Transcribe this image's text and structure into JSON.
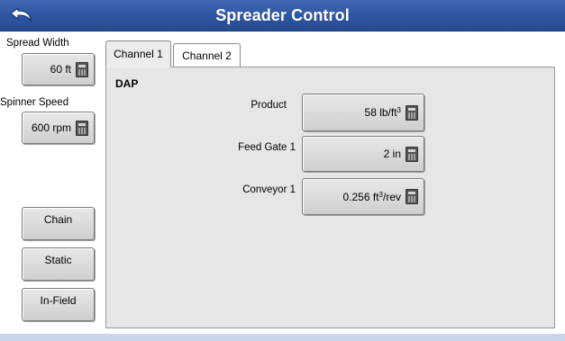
{
  "header": {
    "title": "Spreader Control",
    "back_icon": "back-arrow-icon"
  },
  "sidebar": {
    "spread_width_label": "Spread Width",
    "spread_width_value": "60 ft",
    "spinner_speed_label": "Spinner Speed",
    "spinner_speed_value": "600 rpm",
    "buttons": [
      {
        "label": "Chain"
      },
      {
        "label": "Static"
      },
      {
        "label": "In-Field"
      }
    ]
  },
  "tabs": [
    {
      "label": "Channel 1",
      "active": true
    },
    {
      "label": "Channel 2",
      "active": false
    }
  ],
  "channel": {
    "product_name": "DAP",
    "fields": [
      {
        "label": "Product",
        "value": "58 lb/ft",
        "unit_sup": "3",
        "value_suffix": ""
      },
      {
        "label": "Feed Gate 1",
        "value": "2 in",
        "unit_sup": "",
        "value_suffix": ""
      },
      {
        "label": "Conveyor 1",
        "value": "0.256 ft",
        "unit_sup": "3",
        "value_suffix": "/rev"
      }
    ]
  },
  "icons": {
    "calculator": "calculator-icon"
  },
  "colors": {
    "title_bar": "#2e559f",
    "panel_bg": "#e6e6e6",
    "bottom_strip": "#c9d5ea"
  }
}
